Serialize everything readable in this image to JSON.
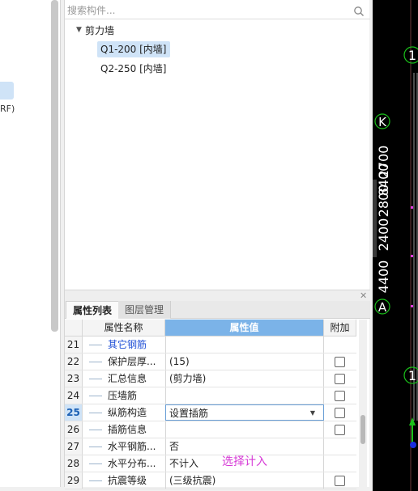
{
  "left_panel": {
    "partial_text": "RF)"
  },
  "search": {
    "placeholder": "搜索构件..."
  },
  "tree": {
    "root": "剪力墙",
    "items": [
      "Q1-200 [内墙]",
      "Q2-250 [内墙]"
    ]
  },
  "tabs": [
    "属性列表",
    "图层管理"
  ],
  "grid": {
    "headers": {
      "name": "属性名称",
      "value": "属性值",
      "extra": "附加"
    },
    "rows": [
      {
        "num": "21",
        "name": "其它钢筋",
        "value": "",
        "checkbox": false,
        "blue": true
      },
      {
        "num": "22",
        "name": "保护层厚...",
        "value": "(15)",
        "checkbox": true
      },
      {
        "num": "23",
        "name": "汇总信息",
        "value": "(剪力墙)",
        "checkbox": true
      },
      {
        "num": "24",
        "name": "压墙筋",
        "value": "",
        "checkbox": true
      },
      {
        "num": "25",
        "name": "纵筋构造",
        "value": "设置插筋",
        "checkbox": true,
        "active": true
      },
      {
        "num": "26",
        "name": "插筋信息",
        "value": "",
        "checkbox": true
      },
      {
        "num": "27",
        "name": "水平钢筋...",
        "value": "否",
        "checkbox": false
      },
      {
        "num": "28",
        "name": "水平分布...",
        "value": "不计入",
        "checkbox": false
      },
      {
        "num": "29",
        "name": "抗震等级",
        "value": "(三级抗震)",
        "checkbox": true
      }
    ]
  },
  "annotation": "选择计入",
  "canvas": {
    "bubbles": [
      "1",
      "K",
      "A",
      "1"
    ],
    "dims": [
      "2700",
      "2800",
      "2400",
      "4400"
    ],
    "overlap_text": "8400"
  },
  "colors": {
    "accent": "#7bb3e8",
    "annotation": "#d63ad6",
    "canvas_bg": "#000000",
    "axis_green": "#1ac11a"
  }
}
